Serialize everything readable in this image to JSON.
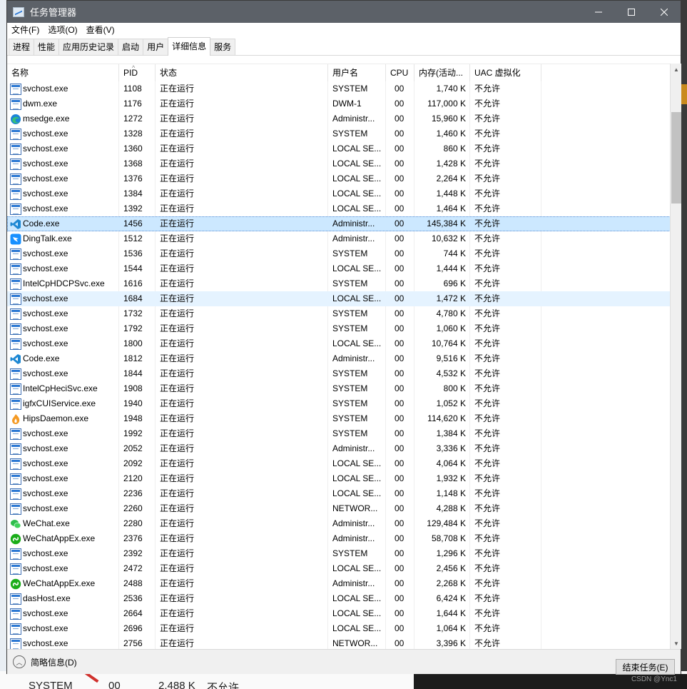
{
  "window": {
    "title": "任务管理器",
    "minimize_glyph": "—",
    "maximize_glyph": "☐",
    "close_glyph": "✕"
  },
  "menu": [
    {
      "label": "文件(F)"
    },
    {
      "label": "选项(O)"
    },
    {
      "label": "查看(V)"
    }
  ],
  "tabs": [
    {
      "label": "进程",
      "active": false
    },
    {
      "label": "性能",
      "active": false
    },
    {
      "label": "应用历史记录",
      "active": false
    },
    {
      "label": "启动",
      "active": false
    },
    {
      "label": "用户",
      "active": false
    },
    {
      "label": "详细信息",
      "active": true
    },
    {
      "label": "服务",
      "active": false
    }
  ],
  "table": {
    "columns": {
      "name": "名称",
      "pid": "PID",
      "status": "状态",
      "user": "用户名",
      "cpu": "CPU",
      "memory": "内存(活动...",
      "uac": "UAC 虚拟化"
    },
    "sort_column": "PID",
    "rows": [
      {
        "name": "svchost.exe",
        "icon": "service-icon",
        "pid": "1108",
        "status": "正在运行",
        "user": "SYSTEM",
        "cpu": "00",
        "mem": "1,740 K",
        "uac": "不允许"
      },
      {
        "name": "dwm.exe",
        "icon": "service-icon",
        "pid": "1176",
        "status": "正在运行",
        "user": "DWM-1",
        "cpu": "00",
        "mem": "117,000 K",
        "uac": "不允许"
      },
      {
        "name": "msedge.exe",
        "icon": "edge-icon",
        "pid": "1272",
        "status": "正在运行",
        "user": "Administr...",
        "cpu": "00",
        "mem": "15,960 K",
        "uac": "不允许"
      },
      {
        "name": "svchost.exe",
        "icon": "service-icon",
        "pid": "1328",
        "status": "正在运行",
        "user": "SYSTEM",
        "cpu": "00",
        "mem": "1,460 K",
        "uac": "不允许"
      },
      {
        "name": "svchost.exe",
        "icon": "service-icon",
        "pid": "1360",
        "status": "正在运行",
        "user": "LOCAL SE...",
        "cpu": "00",
        "mem": "860 K",
        "uac": "不允许"
      },
      {
        "name": "svchost.exe",
        "icon": "service-icon",
        "pid": "1368",
        "status": "正在运行",
        "user": "LOCAL SE...",
        "cpu": "00",
        "mem": "1,428 K",
        "uac": "不允许"
      },
      {
        "name": "svchost.exe",
        "icon": "service-icon",
        "pid": "1376",
        "status": "正在运行",
        "user": "LOCAL SE...",
        "cpu": "00",
        "mem": "2,264 K",
        "uac": "不允许"
      },
      {
        "name": "svchost.exe",
        "icon": "service-icon",
        "pid": "1384",
        "status": "正在运行",
        "user": "LOCAL SE...",
        "cpu": "00",
        "mem": "1,448 K",
        "uac": "不允许"
      },
      {
        "name": "svchost.exe",
        "icon": "service-icon",
        "pid": "1392",
        "status": "正在运行",
        "user": "LOCAL SE...",
        "cpu": "00",
        "mem": "1,464 K",
        "uac": "不允许"
      },
      {
        "name": "Code.exe",
        "icon": "vscode-icon",
        "pid": "1456",
        "status": "正在运行",
        "user": "Administr...",
        "cpu": "00",
        "mem": "145,384 K",
        "uac": "不允许",
        "state": "selected"
      },
      {
        "name": "DingTalk.exe",
        "icon": "dingtalk-icon",
        "pid": "1512",
        "status": "正在运行",
        "user": "Administr...",
        "cpu": "00",
        "mem": "10,632 K",
        "uac": "不允许"
      },
      {
        "name": "svchost.exe",
        "icon": "service-icon",
        "pid": "1536",
        "status": "正在运行",
        "user": "SYSTEM",
        "cpu": "00",
        "mem": "744 K",
        "uac": "不允许"
      },
      {
        "name": "svchost.exe",
        "icon": "service-icon",
        "pid": "1544",
        "status": "正在运行",
        "user": "LOCAL SE...",
        "cpu": "00",
        "mem": "1,444 K",
        "uac": "不允许"
      },
      {
        "name": "IntelCpHDCPSvc.exe",
        "icon": "service-icon",
        "pid": "1616",
        "status": "正在运行",
        "user": "SYSTEM",
        "cpu": "00",
        "mem": "696 K",
        "uac": "不允许"
      },
      {
        "name": "svchost.exe",
        "icon": "service-icon",
        "pid": "1684",
        "status": "正在运行",
        "user": "LOCAL SE...",
        "cpu": "00",
        "mem": "1,472 K",
        "uac": "不允许",
        "state": "hover"
      },
      {
        "name": "svchost.exe",
        "icon": "service-icon",
        "pid": "1732",
        "status": "正在运行",
        "user": "SYSTEM",
        "cpu": "00",
        "mem": "4,780 K",
        "uac": "不允许"
      },
      {
        "name": "svchost.exe",
        "icon": "service-icon",
        "pid": "1792",
        "status": "正在运行",
        "user": "SYSTEM",
        "cpu": "00",
        "mem": "1,060 K",
        "uac": "不允许"
      },
      {
        "name": "svchost.exe",
        "icon": "service-icon",
        "pid": "1800",
        "status": "正在运行",
        "user": "LOCAL SE...",
        "cpu": "00",
        "mem": "10,764 K",
        "uac": "不允许"
      },
      {
        "name": "Code.exe",
        "icon": "vscode-icon",
        "pid": "1812",
        "status": "正在运行",
        "user": "Administr...",
        "cpu": "00",
        "mem": "9,516 K",
        "uac": "不允许"
      },
      {
        "name": "svchost.exe",
        "icon": "service-icon",
        "pid": "1844",
        "status": "正在运行",
        "user": "SYSTEM",
        "cpu": "00",
        "mem": "4,532 K",
        "uac": "不允许"
      },
      {
        "name": "IntelCpHeciSvc.exe",
        "icon": "service-icon",
        "pid": "1908",
        "status": "正在运行",
        "user": "SYSTEM",
        "cpu": "00",
        "mem": "800 K",
        "uac": "不允许"
      },
      {
        "name": "igfxCUIService.exe",
        "icon": "service-icon",
        "pid": "1940",
        "status": "正在运行",
        "user": "SYSTEM",
        "cpu": "00",
        "mem": "1,052 K",
        "uac": "不允许"
      },
      {
        "name": "HipsDaemon.exe",
        "icon": "huorong-icon",
        "pid": "1948",
        "status": "正在运行",
        "user": "SYSTEM",
        "cpu": "00",
        "mem": "114,620 K",
        "uac": "不允许"
      },
      {
        "name": "svchost.exe",
        "icon": "service-icon",
        "pid": "1992",
        "status": "正在运行",
        "user": "SYSTEM",
        "cpu": "00",
        "mem": "1,384 K",
        "uac": "不允许"
      },
      {
        "name": "svchost.exe",
        "icon": "service-icon",
        "pid": "2052",
        "status": "正在运行",
        "user": "Administr...",
        "cpu": "00",
        "mem": "3,336 K",
        "uac": "不允许"
      },
      {
        "name": "svchost.exe",
        "icon": "service-icon",
        "pid": "2092",
        "status": "正在运行",
        "user": "LOCAL SE...",
        "cpu": "00",
        "mem": "4,064 K",
        "uac": "不允许"
      },
      {
        "name": "svchost.exe",
        "icon": "service-icon",
        "pid": "2120",
        "status": "正在运行",
        "user": "LOCAL SE...",
        "cpu": "00",
        "mem": "1,932 K",
        "uac": "不允许"
      },
      {
        "name": "svchost.exe",
        "icon": "service-icon",
        "pid": "2236",
        "status": "正在运行",
        "user": "LOCAL SE...",
        "cpu": "00",
        "mem": "1,148 K",
        "uac": "不允许"
      },
      {
        "name": "svchost.exe",
        "icon": "service-icon",
        "pid": "2260",
        "status": "正在运行",
        "user": "NETWOR...",
        "cpu": "00",
        "mem": "4,288 K",
        "uac": "不允许"
      },
      {
        "name": "WeChat.exe",
        "icon": "wechat-icon",
        "pid": "2280",
        "status": "正在运行",
        "user": "Administr...",
        "cpu": "00",
        "mem": "129,484 K",
        "uac": "不允许"
      },
      {
        "name": "WeChatAppEx.exe",
        "icon": "wechat-mini-icon",
        "pid": "2376",
        "status": "正在运行",
        "user": "Administr...",
        "cpu": "00",
        "mem": "58,708 K",
        "uac": "不允许"
      },
      {
        "name": "svchost.exe",
        "icon": "service-icon",
        "pid": "2392",
        "status": "正在运行",
        "user": "SYSTEM",
        "cpu": "00",
        "mem": "1,296 K",
        "uac": "不允许"
      },
      {
        "name": "svchost.exe",
        "icon": "service-icon",
        "pid": "2472",
        "status": "正在运行",
        "user": "LOCAL SE...",
        "cpu": "00",
        "mem": "2,456 K",
        "uac": "不允许"
      },
      {
        "name": "WeChatAppEx.exe",
        "icon": "wechat-mini-icon",
        "pid": "2488",
        "status": "正在运行",
        "user": "Administr...",
        "cpu": "00",
        "mem": "2,268 K",
        "uac": "不允许"
      },
      {
        "name": "dasHost.exe",
        "icon": "service-icon",
        "pid": "2536",
        "status": "正在运行",
        "user": "LOCAL SE...",
        "cpu": "00",
        "mem": "6,424 K",
        "uac": "不允许"
      },
      {
        "name": "svchost.exe",
        "icon": "service-icon",
        "pid": "2664",
        "status": "正在运行",
        "user": "LOCAL SE...",
        "cpu": "00",
        "mem": "1,644 K",
        "uac": "不允许"
      },
      {
        "name": "svchost.exe",
        "icon": "service-icon",
        "pid": "2696",
        "status": "正在运行",
        "user": "LOCAL SE...",
        "cpu": "00",
        "mem": "1,064 K",
        "uac": "不允许"
      },
      {
        "name": "svchost.exe",
        "icon": "service-icon",
        "pid": "2756",
        "status": "正在运行",
        "user": "NETWOR...",
        "cpu": "00",
        "mem": "3,396 K",
        "uac": "不允许"
      }
    ]
  },
  "footer": {
    "fewer_details": "简略信息(D)",
    "end_task": "结束任务(E)"
  },
  "background": {
    "bottom_text_user": "SYSTEM",
    "bottom_text_cpu": "00",
    "bottom_text_mem": "2,488 K",
    "bottom_text_uac": "不允许",
    "watermark": "CSDN @Ync1"
  },
  "colors": {
    "titlebar": "#5c6168",
    "selection": "#cce8ff",
    "hover": "#e5f3ff"
  }
}
